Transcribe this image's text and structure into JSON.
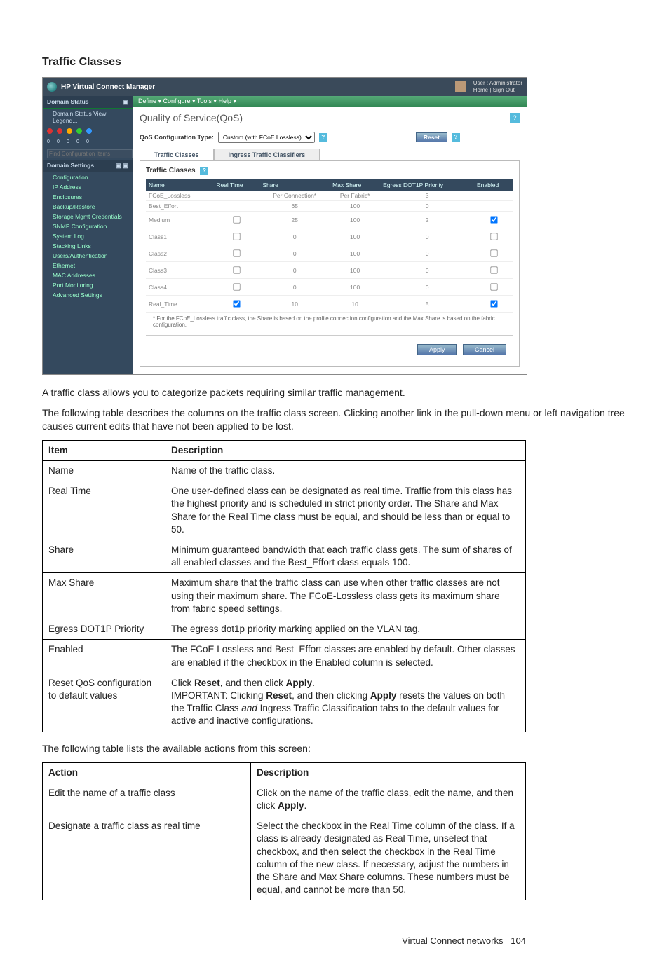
{
  "section_title": "Traffic Classes",
  "screenshot": {
    "topbar": {
      "title": "HP Virtual Connect Manager",
      "user_label": "User : Administrator",
      "links": "Home | Sign Out"
    },
    "left_panel": {
      "domain_status_hdr": "Domain Status",
      "domain_status_row": "Domain Status   View Legend...",
      "find_placeholder": "Find Configuration Items",
      "domain_settings_hdr": "Domain Settings",
      "items": [
        "Configuration",
        "IP Address",
        "Enclosures",
        "Backup/Restore",
        "Storage Mgmt Credentials",
        "SNMP Configuration",
        "System Log",
        "Stacking Links",
        "Users/Authentication",
        "Ethernet",
        "MAC Addresses",
        "Port Monitoring",
        "Advanced Settings"
      ]
    },
    "menubar": "Define ▾    Configure ▾    Tools ▾    Help ▾",
    "page_title": "Quality of Service(QoS)",
    "cfg_label": "QoS Configuration Type:",
    "cfg_value": "Custom (with FCoE Lossless)",
    "reset_btn": "Reset",
    "tab1": "Traffic Classes",
    "tab2": "Ingress Traffic Classifiers",
    "tc_heading": "Traffic Classes",
    "table": {
      "headers": [
        "Name",
        "Real Time",
        "Share",
        "Max Share",
        "Egress DOT1P Priority",
        "Enabled"
      ],
      "rows": [
        {
          "name": "FCoE_Lossless",
          "rt": "",
          "share": "Per Connection*",
          "max": "Per Fabric*",
          "pri": "3",
          "en": null
        },
        {
          "name": "Best_Effort",
          "rt": "",
          "share": "65",
          "max": "100",
          "pri": "0",
          "en": null
        },
        {
          "name": "Medium",
          "rt": false,
          "share": "25",
          "max": "100",
          "pri": "2",
          "en": true
        },
        {
          "name": "Class1",
          "rt": false,
          "share": "0",
          "max": "100",
          "pri": "0",
          "en": false
        },
        {
          "name": "Class2",
          "rt": false,
          "share": "0",
          "max": "100",
          "pri": "0",
          "en": false
        },
        {
          "name": "Class3",
          "rt": false,
          "share": "0",
          "max": "100",
          "pri": "0",
          "en": false
        },
        {
          "name": "Class4",
          "rt": false,
          "share": "0",
          "max": "100",
          "pri": "0",
          "en": false
        },
        {
          "name": "Real_Time",
          "rt": true,
          "share": "10",
          "max": "10",
          "pri": "5",
          "en": true
        }
      ]
    },
    "footnote": "* For the FCoE_Lossless traffic class, the Share is based on the profile connection configuration and the Max Share is based on the fabric configuration.",
    "apply_btn": "Apply",
    "cancel_btn": "Cancel"
  },
  "para1": "A traffic class allows you to categorize packets requiring similar traffic management.",
  "para2": "The following table describes the columns on the traffic class screen. Clicking another link in the pull-down menu or left navigation tree causes current edits that have not been applied to be lost.",
  "columns_table": {
    "header_item": "Item",
    "header_desc": "Description",
    "rows": [
      {
        "item": "Name",
        "desc": "Name of the traffic class."
      },
      {
        "item": "Real Time",
        "desc": "One user-defined class can be designated as real time. Traffic from this class has the highest priority and is scheduled in strict priority order. The Share and Max Share for the Real Time class must be equal, and should be less than or equal to 50."
      },
      {
        "item": "Share",
        "desc": "Minimum guaranteed bandwidth that each traffic class gets. The sum of shares of all enabled classes and the Best_Effort class equals 100."
      },
      {
        "item": "Max Share",
        "desc": "Maximum share that the traffic class can use when other traffic classes are not using their maximum share. The FCoE-Lossless class gets its maximum share from fabric speed settings."
      },
      {
        "item": "Egress DOT1P Priority",
        "desc": "The egress dot1p priority marking applied on the VLAN tag."
      },
      {
        "item": "Enabled",
        "desc": "The FCoE Lossless and Best_Effort classes are enabled by default. Other classes are enabled if the checkbox in the Enabled column is selected."
      }
    ],
    "reset_row": {
      "item": "Reset QoS configuration to default values",
      "pre": "Click ",
      "b1": "Reset",
      "mid1": ", and then click ",
      "b2": "Apply",
      "mid2": ".",
      "line2a": "IMPORTANT: Clicking ",
      "b3": "Reset",
      "line2b": ", and then clicking ",
      "b4": "Apply",
      "line2c": " resets the values on both the Traffic Class ",
      "ital": "and",
      "line2d": " Ingress Traffic Classification tabs to the default values for active and inactive configurations."
    }
  },
  "para3": "The following table lists the available actions from this screen:",
  "actions_table": {
    "header_action": "Action",
    "header_desc": "Description",
    "rows": [
      {
        "action": "Edit the name of a traffic class",
        "desc_pre": "Click on the name of the traffic class, edit the name, and then click ",
        "desc_bold": "Apply",
        "desc_post": "."
      },
      {
        "action": "Designate a traffic class as real time",
        "desc": "Select the checkbox in the Real Time column of the class. If a class is already designated as Real Time, unselect that checkbox, and then select the checkbox in the Real Time column of the new class. If necessary, adjust the numbers in the Share and Max Share columns. These numbers must be equal, and cannot be more than 50."
      }
    ]
  },
  "footer": {
    "text": "Virtual Connect networks",
    "page": "104"
  }
}
